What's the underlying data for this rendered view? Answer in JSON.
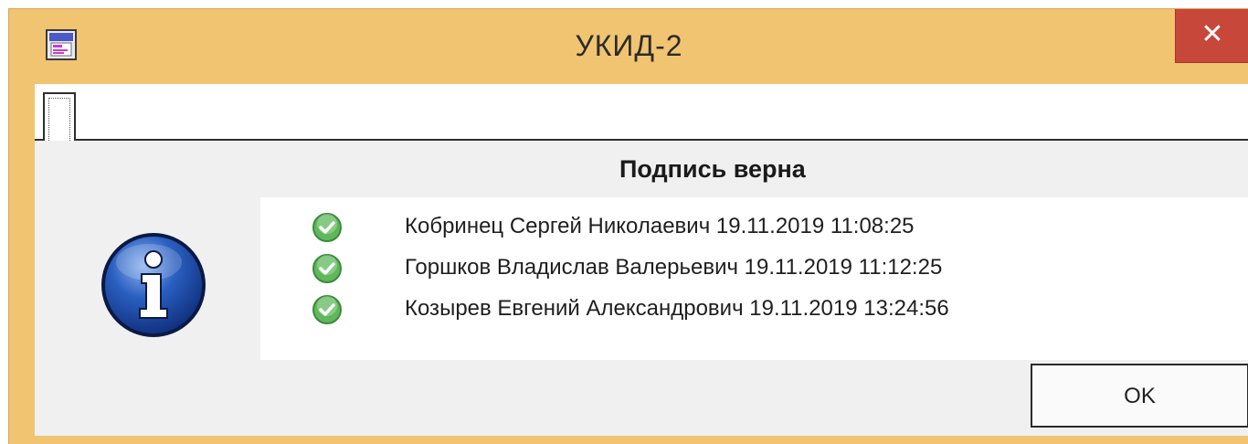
{
  "window": {
    "title": "УКИД-2",
    "app_icon": "app-document-icon",
    "close_label": "✕",
    "frame_color": "#f1c471",
    "close_color": "#c7473a"
  },
  "tabs": [
    {
      "label": ""
    }
  ],
  "dialog": {
    "heading": "Подпись верна",
    "icon": "info-icon",
    "signatures": [
      {
        "icon": "check-circle-icon",
        "text": "Кобринец Сергей Николаевич 19.11.2019 11:08:25"
      },
      {
        "icon": "check-circle-icon",
        "text": "Горшков Владислав Валерьевич 19.11.2019 11:12:25"
      },
      {
        "icon": "check-circle-icon",
        "text": "Козырев Евгений Александрович 19.11.2019 13:24:56"
      }
    ],
    "ok_label": "OK"
  }
}
